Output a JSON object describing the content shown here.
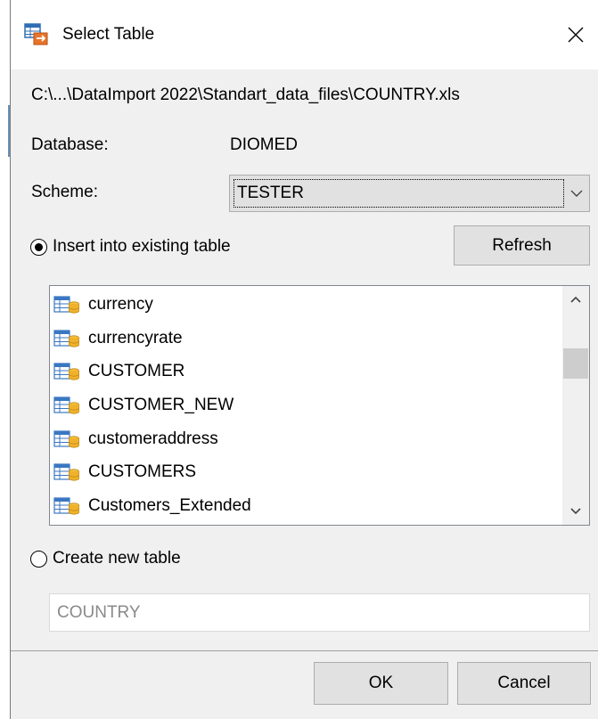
{
  "window": {
    "title": "Select Table"
  },
  "file_path": "C:\\...\\DataImport 2022\\Standart_data_files\\COUNTRY.xls",
  "database": {
    "label": "Database:",
    "value": "DIOMED"
  },
  "scheme": {
    "label": "Scheme:",
    "value": "TESTER"
  },
  "insert_existing": {
    "label": "Insert into existing table",
    "checked": true
  },
  "refresh_label": "Refresh",
  "tables": [
    {
      "name": "currency"
    },
    {
      "name": "currencyrate"
    },
    {
      "name": "CUSTOMER"
    },
    {
      "name": "CUSTOMER_NEW"
    },
    {
      "name": "customeraddress"
    },
    {
      "name": "CUSTOMERS"
    },
    {
      "name": "Customers_Extended"
    }
  ],
  "create_new": {
    "label": "Create new table",
    "checked": false
  },
  "new_table_name": {
    "value": "COUNTRY"
  },
  "buttons": {
    "ok": "OK",
    "cancel": "Cancel"
  },
  "icons": {
    "title": "select-table-icon",
    "close": "close-icon",
    "dropdown": "chevron-down-icon",
    "table": "database-table-icon",
    "scroll_up": "chevron-up-icon",
    "scroll_down": "chevron-down-icon"
  }
}
